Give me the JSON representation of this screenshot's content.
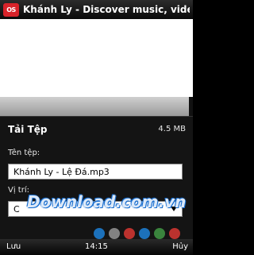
{
  "window": {
    "logo_text": "OS",
    "title": "Khánh Ly - Discover music, video..."
  },
  "dialog": {
    "title": "Tải Tệp",
    "file_size": "4.5 MB",
    "filename_label": "Tên tệp:",
    "filename_value": "Khánh Ly - Lệ Đá.mp3",
    "location_label": "Vị trí:",
    "location_value": "C"
  },
  "watermark": "Download.com.vn",
  "softkeys": {
    "left": "Lưu",
    "time": "14:15",
    "right": "Hủy"
  },
  "colors": {
    "logo": "#d8232a",
    "dots": [
      "#1e88e5",
      "#9e9e9e",
      "#e53935",
      "#1e88e5",
      "#43a047",
      "#e53935"
    ]
  }
}
